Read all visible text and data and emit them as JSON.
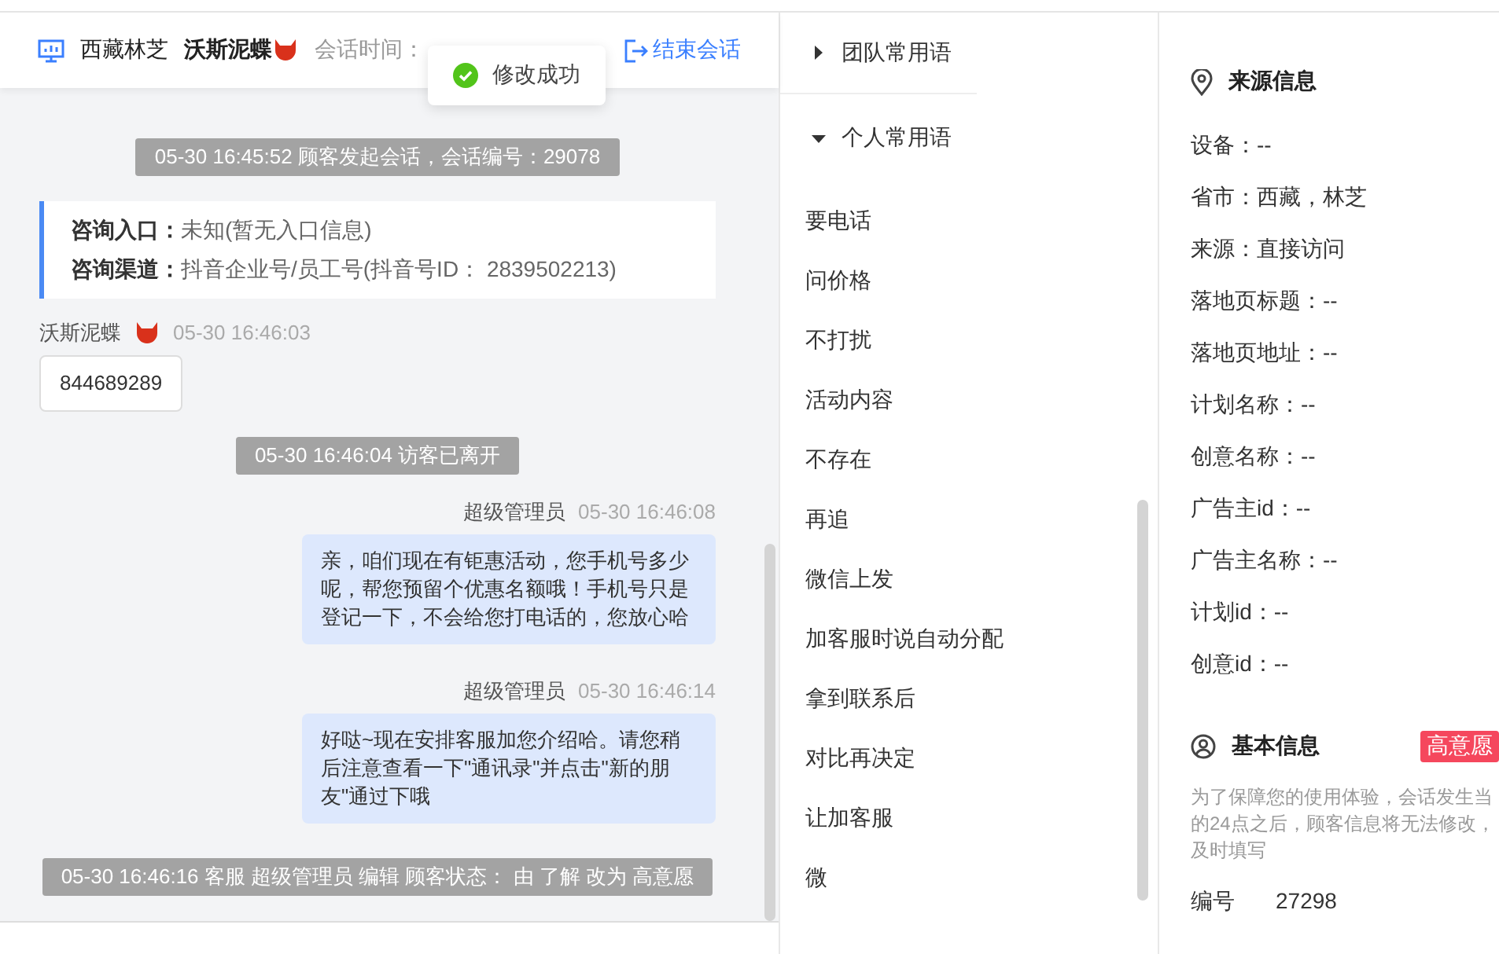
{
  "header": {
    "location": "西藏林芝",
    "customer": "沃斯泥蝶",
    "session_label": "会话时间：",
    "end_button": "结束会话"
  },
  "toast": {
    "text": "修改成功"
  },
  "messages": [
    {
      "kind": "system",
      "text": "05-30 16:45:52 顾客发起会话，会话编号：29078"
    },
    {
      "kind": "info",
      "rows": [
        {
          "label": "咨询入口：",
          "value": "未知(暂无入口信息)"
        },
        {
          "label": "咨询渠道：",
          "value": "抖音企业号/员工号(抖音号ID： 2839502213)"
        }
      ]
    },
    {
      "kind": "visitor",
      "name": "沃斯泥蝶",
      "time": "05-30 16:46:03",
      "text": "844689289"
    },
    {
      "kind": "system",
      "text": "05-30 16:46:04 访客已离开"
    },
    {
      "kind": "agent",
      "name": "超级管理员",
      "time": "05-30 16:46:08",
      "text": "亲，咱们现在有钜惠活动，您手机号多少呢，帮您预留个优惠名额哦！手机号只是登记一下，不会给您打电话的，您放心哈"
    },
    {
      "kind": "agent",
      "name": "超级管理员",
      "time": "05-30 16:46:14",
      "text": "好哒~现在安排客服加您介绍哈。请您稍后注意查看一下\"通讯录\"并点击\"新的朋友\"通过下哦"
    },
    {
      "kind": "system",
      "text": "05-30 16:46:16 客服 超级管理员 编辑 顾客状态： 由 了解 改为 高意愿"
    }
  ],
  "phrases": [
    {
      "title": "团队常用语",
      "expanded": false
    },
    {
      "title": "个人常用语",
      "expanded": true,
      "items": [
        "要电话",
        "问价格",
        "不打扰",
        "活动内容",
        "不存在",
        "再追",
        "微信上发",
        "加客服时说自动分配",
        "拿到联系后",
        "对比再决定",
        "让加客服",
        "微"
      ]
    }
  ],
  "source": {
    "title": "来源信息",
    "fields": [
      "设备：--",
      "省市：西藏，林芝",
      "来源：直接访问",
      "落地页标题：--",
      "落地页地址：--",
      "计划名称：--",
      "创意名称：--",
      "广告主id：--",
      "广告主名称：--",
      "计划id：--",
      "创意id：--"
    ]
  },
  "basic": {
    "title": "基本信息",
    "status": "高意愿",
    "notice": [
      "为了保障您的使用体验，会话发生当",
      "的24点之后，顾客信息将无法修改，",
      "及时填写"
    ],
    "fields": [
      {
        "label": "编号",
        "value": "27298"
      }
    ]
  }
}
